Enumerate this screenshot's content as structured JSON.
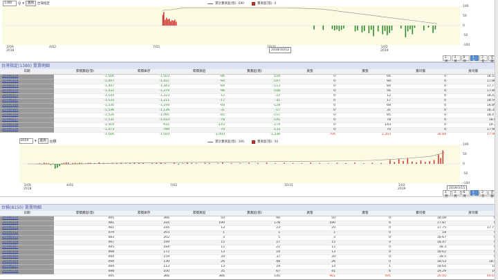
{
  "colors": {
    "up": "#d13b36",
    "down": "#2c8a2c",
    "accent": "#5b8fd0",
    "title_text": "#4a56a8"
  },
  "chart1": {
    "code_select": "1380",
    "search_icon": "search-icon",
    "zoom_icon": "chevron-down-icon",
    "go_button": "查詢",
    "stock_name": "台灣指定",
    "legend_line": "累計賣買超(張): 690",
    "legend_bar": "賣買超(張): 0",
    "yticks": [
      "100",
      "50",
      "0",
      "-50",
      "-100"
    ],
    "xticks": [
      {
        "label": "3/09\n2018",
        "x": 6
      },
      {
        "label": "4/02",
        "x": 68
      },
      {
        "label": "7/02",
        "x": 218
      },
      {
        "label": "10/31",
        "x": 383
      },
      {
        "label": "1/02\n2019",
        "x": 547
      }
    ],
    "tooltip": "2018/10/12",
    "ranges": [
      "1月",
      "3月",
      "6月",
      "1年",
      "2年",
      "全部"
    ],
    "range_active": 3
  },
  "table1": {
    "title": "台灣指定(1380) 賣賣明細",
    "headers": [
      "日期",
      "累積賣超(張)",
      "累積庫存",
      "累積買超",
      "賣賣超(張)",
      "買張",
      "賣張",
      "賣均價",
      "買均價"
    ],
    "rows": [
      [
        "20190315",
        "-1,506",
        "-1,503",
        "-86",
        "-128",
        "0",
        "66",
        "0",
        "18.18"
      ],
      [
        "20190314",
        "-1,447",
        "-1,437",
        "-94",
        "-147",
        "0",
        "94",
        "0",
        "17.86"
      ],
      [
        "20190313",
        "-1,447",
        "-1,343",
        "-84",
        "-113",
        "0",
        "84",
        "0",
        "17.77"
      ],
      [
        "20190312",
        "-1,432",
        "-1,279",
        "-96",
        "-108",
        "0",
        "56",
        "0",
        "17.86"
      ],
      [
        "20190311",
        "-1,544",
        "-1,223",
        "-12",
        "-22",
        "0",
        "12",
        "0",
        "18.42"
      ],
      [
        "20190307",
        "-1,533",
        "-1,211",
        "-17",
        "-31",
        "0",
        "17",
        "0",
        "18.59"
      ],
      [
        "20190306",
        "-1,536",
        "-1,194",
        "-68",
        "-128",
        "0",
        "68",
        "0",
        "18.89"
      ],
      [
        "20190305",
        "-1,536",
        "-1,126",
        "-31",
        "-57",
        "0",
        "31",
        "0",
        "18.35"
      ],
      [
        "20190304",
        "-1,526",
        "-1,095",
        "-85",
        "-157",
        "0",
        "85",
        "0",
        "18.47"
      ],
      [
        "20190227",
        "-1,531",
        "-1,010",
        "-78",
        "-145",
        "0",
        "78",
        "0",
        "18.6"
      ],
      [
        "20190226",
        "-1,564",
        "-932",
        "-143",
        "-274",
        "0",
        "143",
        "0",
        "19.2"
      ],
      [
        "20190129",
        "-1,473",
        "-789",
        "-70",
        "-133",
        "0",
        "70",
        "0",
        "17.96"
      ]
    ],
    "summary": [
      "",
      "-1,506",
      "-1,503",
      "-1,003",
      "-1,238",
      "706",
      "2,203",
      "38.84",
      "17.96"
    ]
  },
  "chart2": {
    "code_select": "8150",
    "go_button": "查詢",
    "stock_name": "台積",
    "legend_line": "累計賣買超(張): 366",
    "legend_bar": "賣買超(張): 50",
    "yticks": [
      "100",
      "50",
      "0",
      "-50",
      "-100"
    ],
    "xticks": [
      {
        "label": "3/09\n2018",
        "x": 6
      },
      {
        "label": "4/02",
        "x": 68
      },
      {
        "label": "7/02",
        "x": 218
      },
      {
        "label": "10/31",
        "x": 383
      },
      {
        "label": "1/02\n2019",
        "x": 547
      }
    ],
    "tooltip": "2019/3/15",
    "ranges": [
      "1月",
      "3月",
      "6月",
      "1年",
      "2年",
      "全部"
    ],
    "range_active": 3
  },
  "table2": {
    "title": "台積(8150) 賣賣明細",
    "headers": [
      "日期",
      "累積賣超(張)",
      "累積庫存",
      "累積買超",
      "賣賣超(張)",
      "買張",
      "賣張",
      "賣均價",
      "買均價"
    ],
    "rows": [
      [
        "20190315",
        "495",
        "366",
        "50",
        "90",
        "50",
        "0",
        "18.08",
        "0"
      ],
      [
        "20190314",
        "481",
        "316",
        "190",
        "178",
        "180",
        "0",
        "17.87",
        "0"
      ],
      [
        "20190313",
        "481",
        "216",
        "13",
        "23",
        "20",
        "0",
        "17.75",
        "17.71"
      ],
      [
        "20190312",
        "479",
        "203",
        "1",
        "1",
        "1",
        "0",
        "18",
        "0"
      ],
      [
        "20190311",
        "483",
        "202",
        "3",
        "5",
        "3",
        "0",
        "18.67",
        "0"
      ],
      [
        "20190308",
        "497",
        "199",
        "15",
        "27",
        "15",
        "0",
        "18.47",
        "0"
      ],
      [
        "20190307",
        "495",
        "184",
        "12",
        "22",
        "12",
        "0",
        "18.3",
        "0"
      ],
      [
        "20190306",
        "498",
        "172",
        "13",
        "24",
        "13",
        "0",
        "18.62",
        "0"
      ],
      [
        "20190305",
        "494",
        "159",
        "20",
        "37",
        "20",
        "0",
        "18.5",
        "0"
      ],
      [
        "20190304",
        "494",
        "139",
        "26",
        "48",
        "26",
        "0",
        "18.53",
        "18.5"
      ],
      [
        "20190227",
        "494",
        "113",
        "13",
        "24",
        "14",
        "1",
        "18.64",
        "19"
      ],
      [
        "20190226",
        "498",
        "100",
        "35",
        "67",
        "41",
        "6",
        "19.29",
        "19"
      ]
    ],
    "summary": [
      "",
      "495",
      "366",
      "366",
      "140",
      "961",
      "595",
      "26.00",
      "40.65"
    ]
  },
  "chart_data": [
    {
      "type": "bar",
      "ylim": [
        -100,
        100
      ],
      "series": [
        {
          "name": "累計賣買超(張)",
          "kind": "line"
        },
        {
          "name": "賣買超(張)",
          "kind": "bar"
        }
      ],
      "bars": [
        [
          0.35,
          55
        ],
        [
          0.352,
          70
        ],
        [
          0.355,
          30
        ],
        [
          0.358,
          40
        ],
        [
          0.361,
          32
        ],
        [
          0.364,
          35
        ],
        [
          0.367,
          22
        ],
        [
          0.37,
          28
        ],
        [
          0.373,
          25
        ],
        [
          0.376,
          30
        ],
        [
          0.379,
          20
        ],
        [
          0.68,
          -20
        ],
        [
          0.7,
          -22
        ],
        [
          0.72,
          -18
        ],
        [
          0.725,
          -25
        ],
        [
          0.73,
          -20
        ],
        [
          0.735,
          -28
        ],
        [
          0.74,
          -22
        ],
        [
          0.745,
          -15
        ],
        [
          0.77,
          -30
        ],
        [
          0.775,
          -25
        ],
        [
          0.785,
          -35
        ],
        [
          0.79,
          -28
        ],
        [
          0.8,
          -40
        ],
        [
          0.805,
          -22
        ],
        [
          0.81,
          -55
        ],
        [
          0.82,
          -30
        ],
        [
          0.83,
          -45
        ],
        [
          0.835,
          -28
        ],
        [
          0.84,
          -50
        ],
        [
          0.845,
          -38
        ],
        [
          0.85,
          -25
        ],
        [
          0.87,
          -15
        ],
        [
          0.88,
          -60
        ],
        [
          0.885,
          -30
        ],
        [
          0.89,
          -20
        ],
        [
          0.895,
          -45
        ],
        [
          0.9,
          -12
        ],
        [
          0.92,
          -25
        ],
        [
          0.93,
          -10
        ],
        [
          0.94,
          -38
        ],
        [
          0.945,
          -20
        ]
      ],
      "line": [
        [
          0.35,
          78
        ],
        [
          0.37,
          82
        ],
        [
          0.385,
          88
        ],
        [
          0.4,
          92
        ],
        [
          0.45,
          92
        ],
        [
          0.55,
          92
        ],
        [
          0.6,
          91
        ],
        [
          0.65,
          90
        ],
        [
          0.7,
          85
        ],
        [
          0.75,
          70
        ],
        [
          0.8,
          55
        ],
        [
          0.85,
          40
        ],
        [
          0.9,
          25
        ],
        [
          0.95,
          10
        ]
      ]
    },
    {
      "type": "bar",
      "ylim": [
        -100,
        100
      ],
      "series": [
        {
          "name": "累計賣買超(張)",
          "kind": "line"
        },
        {
          "name": "賣買超(張)",
          "kind": "bar"
        }
      ],
      "bars": [
        [
          0.04,
          2
        ],
        [
          0.045,
          3
        ],
        [
          0.05,
          -3
        ],
        [
          0.055,
          6
        ],
        [
          0.06,
          4
        ],
        [
          0.065,
          3
        ],
        [
          0.07,
          -5
        ],
        [
          0.075,
          2
        ],
        [
          0.08,
          -25
        ],
        [
          0.085,
          -20
        ],
        [
          0.09,
          -12
        ],
        [
          0.095,
          3
        ],
        [
          0.1,
          5
        ],
        [
          0.105,
          8
        ],
        [
          0.11,
          6
        ],
        [
          0.12,
          4
        ],
        [
          0.125,
          5
        ],
        [
          0.13,
          3
        ],
        [
          0.135,
          6
        ],
        [
          0.14,
          4
        ],
        [
          0.15,
          3
        ],
        [
          0.155,
          5
        ],
        [
          0.16,
          6
        ],
        [
          0.17,
          4
        ],
        [
          0.18,
          8
        ],
        [
          0.19,
          5
        ],
        [
          0.2,
          3
        ],
        [
          0.21,
          5
        ],
        [
          0.22,
          4
        ],
        [
          0.23,
          6
        ],
        [
          0.24,
          3
        ],
        [
          0.25,
          5
        ],
        [
          0.26,
          6
        ],
        [
          0.27,
          4
        ],
        [
          0.28,
          5
        ],
        [
          0.3,
          3
        ],
        [
          0.31,
          4
        ],
        [
          0.32,
          6
        ],
        [
          0.33,
          3
        ],
        [
          0.35,
          5
        ],
        [
          0.36,
          -4
        ],
        [
          0.37,
          3
        ],
        [
          0.38,
          6
        ],
        [
          0.39,
          4
        ],
        [
          0.4,
          3
        ],
        [
          0.42,
          5
        ],
        [
          0.43,
          4
        ],
        [
          0.45,
          3
        ],
        [
          0.46,
          6
        ],
        [
          0.48,
          4
        ],
        [
          0.5,
          3
        ],
        [
          0.52,
          5
        ],
        [
          0.54,
          4
        ],
        [
          0.56,
          6
        ],
        [
          0.58,
          3
        ],
        [
          0.6,
          5
        ],
        [
          0.62,
          4
        ],
        [
          0.64,
          3
        ],
        [
          0.66,
          6
        ],
        [
          0.68,
          4
        ],
        [
          0.7,
          3
        ],
        [
          0.72,
          5
        ],
        [
          0.74,
          4
        ],
        [
          0.76,
          6
        ],
        [
          0.78,
          3
        ],
        [
          0.8,
          5
        ],
        [
          0.82,
          4
        ],
        [
          0.84,
          20
        ],
        [
          0.85,
          10
        ],
        [
          0.86,
          25
        ],
        [
          0.87,
          15
        ],
        [
          0.88,
          30
        ],
        [
          0.89,
          12
        ],
        [
          0.9,
          8
        ],
        [
          0.91,
          18
        ],
        [
          0.92,
          10
        ],
        [
          0.93,
          14
        ],
        [
          0.94,
          20
        ],
        [
          0.95,
          50
        ],
        [
          0.955,
          30
        ],
        [
          0.96,
          70
        ]
      ],
      "line": [
        [
          0.02,
          0
        ],
        [
          0.1,
          -2
        ],
        [
          0.2,
          3
        ],
        [
          0.3,
          6
        ],
        [
          0.4,
          8
        ],
        [
          0.5,
          10
        ],
        [
          0.6,
          12
        ],
        [
          0.7,
          14
        ],
        [
          0.8,
          18
        ],
        [
          0.85,
          24
        ],
        [
          0.9,
          32
        ],
        [
          0.93,
          38
        ],
        [
          0.95,
          48
        ],
        [
          0.965,
          60
        ]
      ]
    }
  ]
}
